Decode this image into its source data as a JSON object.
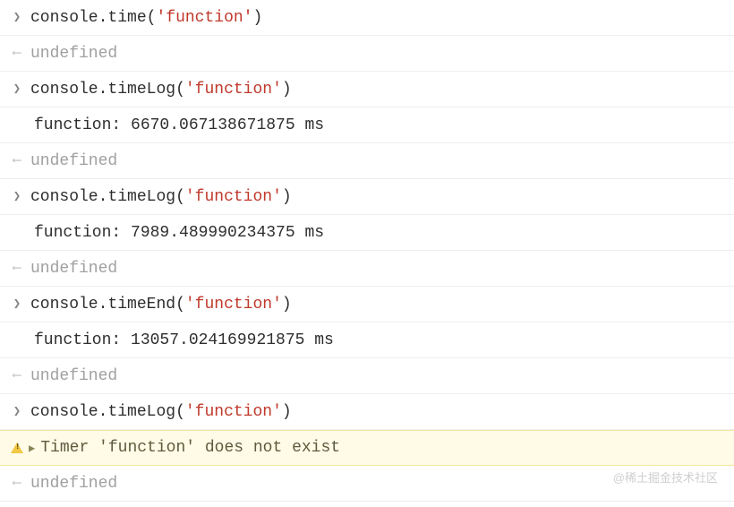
{
  "tokens": {
    "console": "console",
    "dot": ".",
    "time": "time",
    "timeLog": "timeLog",
    "timeEnd": "timeEnd",
    "lparen": "(",
    "rparen": ")",
    "arg": "'function'"
  },
  "results": {
    "undefined": "undefined",
    "log1": "function: 6670.067138671875 ms",
    "log2": "function: 7989.489990234375 ms",
    "log3": "function: 13057.024169921875 ms"
  },
  "warning": {
    "message": "Timer 'function' does not exist"
  },
  "watermark": "@稀土掘金技术社区"
}
